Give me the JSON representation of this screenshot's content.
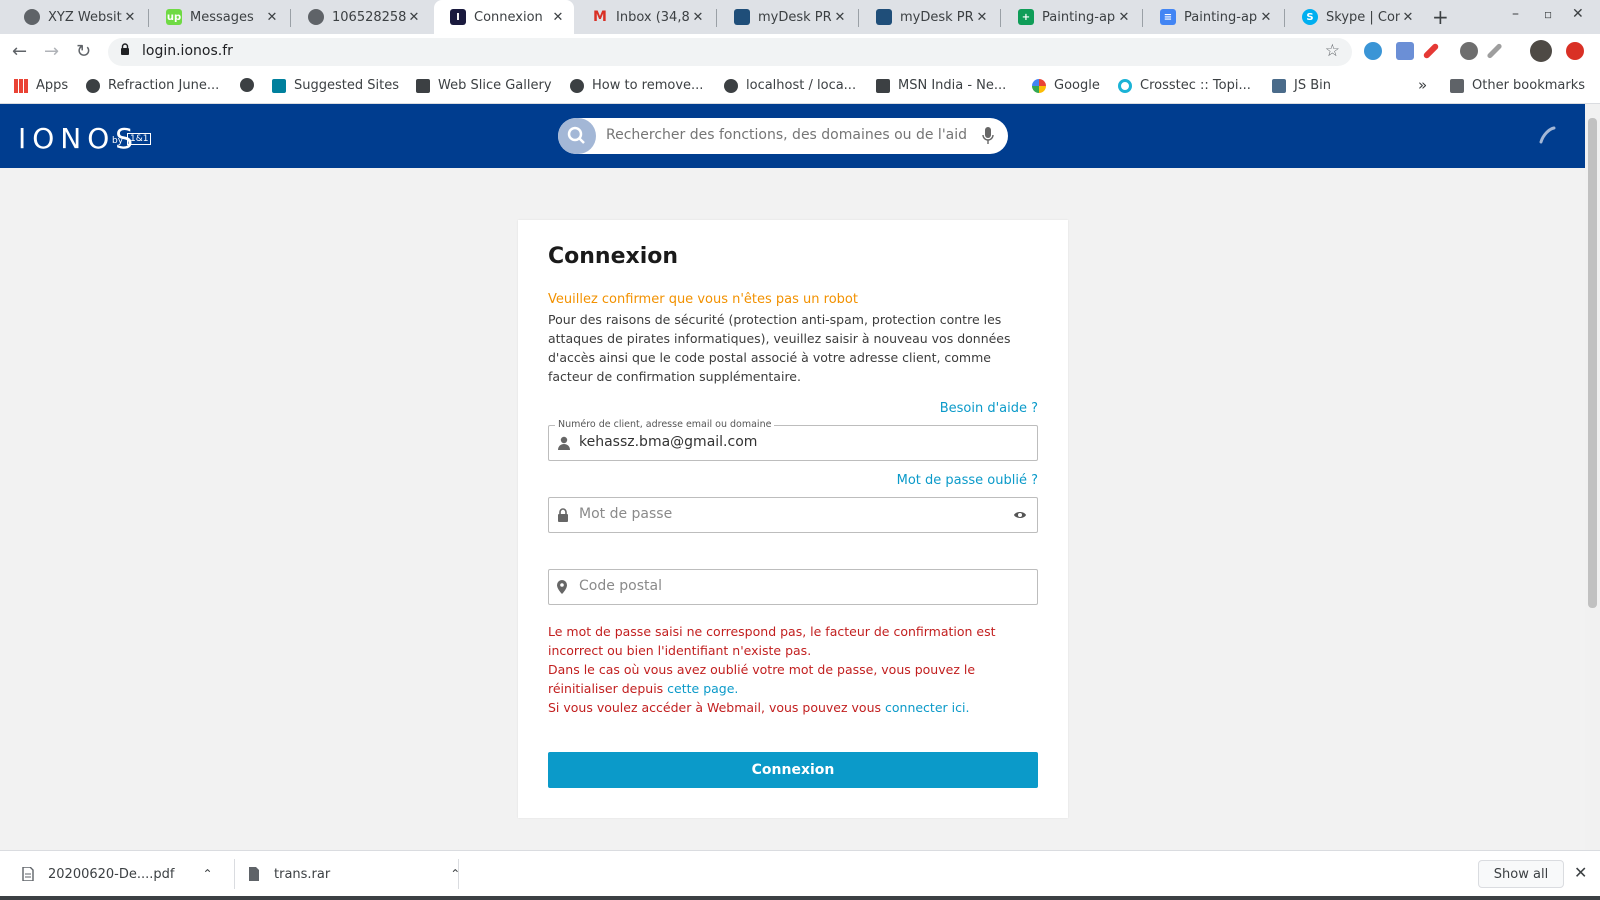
{
  "browser": {
    "tabs": [
      {
        "title": "XYZ Website",
        "favicon": "globe-icon",
        "color": "#5f6368"
      },
      {
        "title": "Messages",
        "favicon": "upwork-icon",
        "color": "#6fda44"
      },
      {
        "title": "106528258",
        "favicon": "globe-icon",
        "color": "#5f6368"
      },
      {
        "title": "Connexion",
        "favicon": "ionos-icon",
        "color": "#1a1a3e"
      },
      {
        "title": "Inbox (34,8",
        "favicon": "gmail-icon",
        "color": "#d93025"
      },
      {
        "title": "myDesk PR",
        "favicon": "mydesk-icon",
        "color": "#1f4e79"
      },
      {
        "title": "myDesk PR",
        "favicon": "mydesk-icon",
        "color": "#1f4e79"
      },
      {
        "title": "Painting-ap",
        "favicon": "sheets-icon",
        "color": "#0f9d58"
      },
      {
        "title": "Painting-ap",
        "favicon": "docs-icon",
        "color": "#4285f4"
      },
      {
        "title": "Skype | Con",
        "favicon": "skype-icon",
        "color": "#00aff0"
      }
    ],
    "url": "login.ionos.fr",
    "bookmarks": [
      {
        "label": "Apps",
        "icon": "apps-grid-icon"
      },
      {
        "label": "Refraction June...",
        "icon": "globe-icon"
      },
      {
        "label": "",
        "icon": "globe-icon"
      },
      {
        "label": "Suggested Sites",
        "icon": "bing-icon"
      },
      {
        "label": "Web Slice Gallery",
        "icon": "web-slice-icon"
      },
      {
        "label": "How to remove...",
        "icon": "globe-icon"
      },
      {
        "label": "localhost / loca...",
        "icon": "globe-icon"
      },
      {
        "label": "MSN India - Ne...",
        "icon": "msn-icon"
      },
      {
        "label": "Google",
        "icon": "google-icon"
      },
      {
        "label": "Crosstec :: Topi...",
        "icon": "crosstec-icon"
      },
      {
        "label": "JS Bin",
        "icon": "jsbin-icon"
      }
    ],
    "bookmarks_overflow": "»",
    "other_bookmarks": "Other bookmarks"
  },
  "header": {
    "logo": "IONOS",
    "logo_by": "by",
    "logo_brand": "1&1",
    "search_placeholder": "Rechercher des fonctions, des domaines ou de l'aide"
  },
  "login": {
    "title": "Connexion",
    "robot_notice": "Veuillez confirmer que vous n'êtes pas un robot",
    "description": "Pour des raisons de sécurité (protection anti-spam, protection contre les attaques de pirates informatiques), veuillez saisir à nouveau vos données d'accès ainsi que le code postal associé à votre adresse client, comme facteur de confirmation supplémentaire.",
    "help_link": "Besoin d'aide ?",
    "email_label": "Numéro de client, adresse email ou domaine",
    "email_value": "kehassz.bma@gmail.com",
    "forgot_link": "Mot de passe oublié ?",
    "password_placeholder": "Mot de passe",
    "postal_placeholder": "Code postal",
    "error_line1": "Le mot de passe saisi ne correspond pas, le facteur de confirmation est incorrect ou bien l'identifiant n'existe pas.",
    "error_line2": "Dans le cas où vous avez oublié votre mot de passe, vous pouvez le réinitialiser depuis",
    "error_line2_link": "cette page.",
    "error_line3": "Si vous voulez accéder à Webmail, vous pouvez vous",
    "error_line3_link": "connecter ici.",
    "submit_label": "Connexion"
  },
  "downloads": [
    {
      "name": "20200620-De....pdf",
      "icon": "pdf-file-icon"
    },
    {
      "name": "trans.rar",
      "icon": "archive-file-icon"
    }
  ],
  "downloads_show_all": "Show all",
  "colors": {
    "brand": "#003d8f",
    "accent": "#0b9ac9",
    "warning": "#f29100",
    "error": "#c21f1f"
  }
}
